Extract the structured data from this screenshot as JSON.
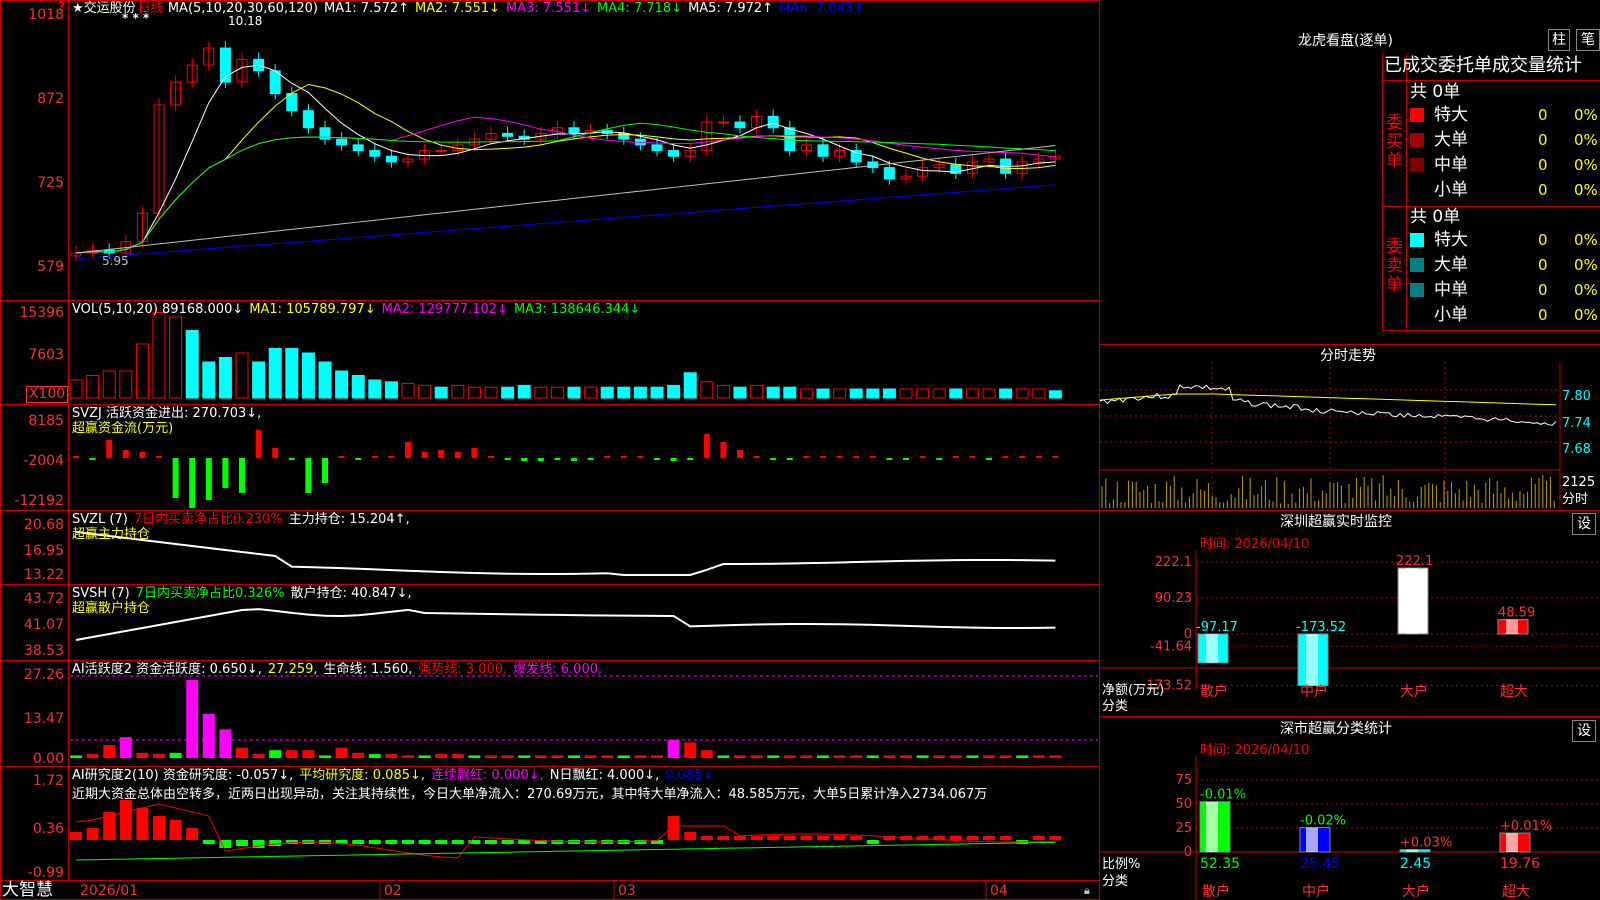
{
  "app": {
    "name": "大智慧"
  },
  "stock": {
    "name": "交运股份",
    "period": "日线"
  },
  "main": {
    "y_ticks": [
      "1018",
      "872",
      "725",
      "579"
    ],
    "ma_legend": [
      {
        "label": "MA(5,10,20,30,60,120)",
        "color": "#ffffff"
      },
      {
        "label": "MA1: 7.572↑",
        "color": "#ffffff"
      },
      {
        "label": "MA2: 7.551↓",
        "color": "#ffff00"
      },
      {
        "label": "MA3: 7.551↓",
        "color": "#ff00ff"
      },
      {
        "label": "MA4: 7.718↓",
        "color": "#00ff00"
      },
      {
        "label": "MA5: 7.972↑",
        "color": "#ffffff"
      },
      {
        "label": "MA6: 7.043↑",
        "color": "#0000ff"
      }
    ],
    "high_label": "10.18",
    "low_label": "5.95",
    "stars": "* * *"
  },
  "vol": {
    "y_ticks": [
      "15396",
      "7603",
      "X100"
    ],
    "legend": [
      {
        "label": "VOL(5,10,20)  89168.000↓",
        "color": "#ffffff"
      },
      {
        "label": "MA1: 105789.797↓",
        "color": "#ffff00"
      },
      {
        "label": "MA2: 129777.102↓",
        "color": "#ff00ff"
      },
      {
        "label": "MA3: 138646.344↓",
        "color": "#00ff00"
      }
    ]
  },
  "svzj": {
    "y_ticks": [
      "8185",
      "-2004",
      "-12192"
    ],
    "legend": [
      {
        "label": "SVZJ  活跃资金进出: 270.703↓,",
        "color": "#ffffff"
      }
    ],
    "sub_label": "超赢资金流(万元)"
  },
  "svzl": {
    "y_ticks": [
      "20.68",
      "16.95",
      "13.22"
    ],
    "legend": [
      {
        "label": "SVZL (7)",
        "color": "#ffffff"
      },
      {
        "label": "7日内买卖净占比0.230%",
        "color": "#ff0000"
      },
      {
        "label": "主力持仓: 15.204↑,",
        "color": "#ffffff"
      }
    ],
    "sub_label": "超赢主力持仓"
  },
  "svsh": {
    "y_ticks": [
      "43.72",
      "41.07",
      "38.53"
    ],
    "legend": [
      {
        "label": "SVSH (7)",
        "color": "#ffffff"
      },
      {
        "label": "7日内买卖净占比0.326%",
        "color": "#00ff00"
      },
      {
        "label": "散户持仓: 40.847↓,",
        "color": "#ffffff"
      }
    ],
    "sub_label": "超赢散户持仓"
  },
  "ai1": {
    "y_ticks": [
      "27.26",
      "13.47",
      "0.00"
    ],
    "legend": [
      {
        "label": "AI活跃度2 资金活跃度: 0.650↓,",
        "color": "#ffffff"
      },
      {
        "label": "27.259,",
        "color": "#ffff00"
      },
      {
        "label": "生命线: 1.560,",
        "color": "#ffffff"
      },
      {
        "label": "强势线: 3.000,",
        "color": "#ff0000"
      },
      {
        "label": "爆发线: 6.000,",
        "color": "#ff00ff"
      }
    ]
  },
  "ai2": {
    "y_ticks": [
      "1.72",
      "0.36",
      "-0.99"
    ],
    "legend": [
      {
        "label": "AI研究度2(10) 资金研究度: -0.057↓,",
        "color": "#ffffff"
      },
      {
        "label": "平均研究度: 0.085↓,",
        "color": "#ffff00"
      },
      {
        "label": "连续飘红: 0.000↓,",
        "color": "#ff00ff"
      },
      {
        "label": "N日飘红: 4.000↓,",
        "color": "#ffffff"
      },
      {
        "label": "0.085↓",
        "color": "#0000ff"
      }
    ],
    "summary": "近期大资金总体由空转多，近两日出现异动，关注其持续性，今日大单净流入：270.69万元，其中特大单净流入：48.585万元，大单5日累计净入2734.067万"
  },
  "x_axis": {
    "labels": [
      "2026/01",
      "02",
      "03",
      "04"
    ]
  },
  "right": {
    "dragon_title": "龙虎看盘(逐单)",
    "btn_zhu": "柱",
    "btn_bi": "笔",
    "stat_header": "已成交委托单成交量统计",
    "buy_side": {
      "side_label": "委买单",
      "total": "共 0单",
      "rows": [
        {
          "label": "特大",
          "count": "0",
          "pct": "0%",
          "color": "#ff0000"
        },
        {
          "label": "大单",
          "count": "0",
          "pct": "0%",
          "color": "#a00000"
        },
        {
          "label": "中单",
          "count": "0",
          "pct": "0%",
          "color": "#800000"
        },
        {
          "label": "小单",
          "count": "0",
          "pct": "0%",
          "color": ""
        }
      ]
    },
    "sell_side": {
      "side_label": "委卖单",
      "total": "共 0单",
      "rows": [
        {
          "label": "特大",
          "count": "0",
          "pct": "0%",
          "color": "#00ffff"
        },
        {
          "label": "大单",
          "count": "0",
          "pct": "0%",
          "color": "#008080"
        },
        {
          "label": "中单",
          "count": "0",
          "pct": "0%",
          "color": "#008080"
        },
        {
          "label": "小单",
          "count": "0",
          "pct": "0%",
          "color": ""
        }
      ]
    },
    "intraday": {
      "title": "分时走势",
      "y_ticks": [
        "7.80",
        "7.74",
        "7.68"
      ],
      "vol_tick": "2125",
      "vol_unit": "分时"
    },
    "monitor": {
      "title": "深圳超赢实时监控",
      "settings": "设",
      "time": "时间: 2026/04/10",
      "y_ticks": [
        "222.1",
        "90.23",
        "0",
        "-41.64",
        "-173.52"
      ],
      "axis_label_1": "净额(万元)",
      "axis_label_2": "分类",
      "cats": [
        "散户",
        "中户",
        "大户",
        "超大"
      ],
      "values": [
        "-97.17",
        "-173.52",
        "222.1",
        "48.59"
      ]
    },
    "classify": {
      "title": "深市超赢分类统计",
      "settings": "设",
      "time": "时间: 2026/04/10",
      "y_ticks": [
        "75",
        "50",
        "25",
        "0"
      ],
      "axis_label_1": "比例%",
      "axis_label_2": "分类",
      "cats": [
        "散户",
        "中户",
        "大户",
        "超大"
      ],
      "changes": [
        "-0.01%",
        "-0.02%",
        "+0.03%",
        "+0.01%"
      ],
      "values": [
        "52.35",
        "25.45",
        "2.45",
        "19.76"
      ]
    }
  },
  "colors": {
    "up": "#ff0000",
    "down": "#00ffff",
    "grid": "#c00000"
  }
}
